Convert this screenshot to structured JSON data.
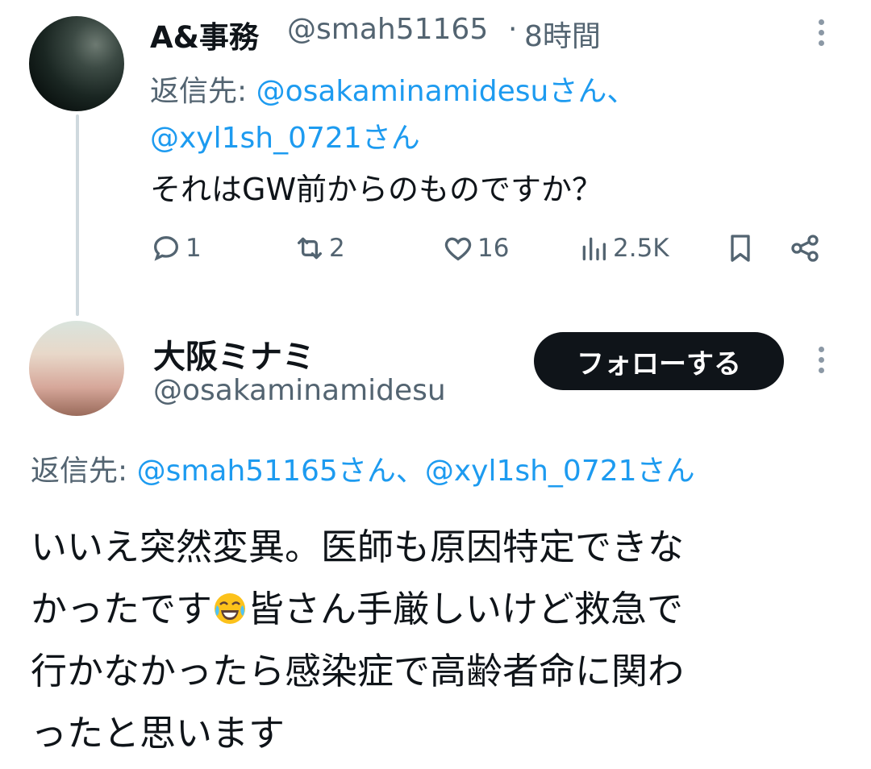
{
  "tweet1": {
    "display_name": "A&事務",
    "handle": "@smah51165",
    "separator": "·",
    "time": "8時間",
    "reply_to_label": "返信先:",
    "reply_to_line1_mention": "@osakaminamidesu",
    "reply_to_line1_suffix": "さん、",
    "reply_to_line2_mention": "@xyl1sh_0721",
    "reply_to_line2_suffix": "さん",
    "text": "それはGW前からのものですか？",
    "actions": {
      "replies": "1",
      "reposts": "2",
      "likes": "16",
      "views": "2.5K"
    }
  },
  "tweet2": {
    "display_name": "大阪ミナミ",
    "handle": "@osakaminamidesu",
    "follow_label": "フォローする",
    "reply_to_label": "返信先:",
    "reply_mention1": "@smah51165",
    "reply_sep": "さん、",
    "reply_mention2": "@xyl1sh_0721",
    "reply_suffix": "さん",
    "text_lines": [
      "いいえ突然変異。医師も原因特定できな",
      "かったです",
      "皆さん手厳しいけど救急で",
      "行かなかったら感染症で高齢者命に関わ",
      "ったと思います"
    ]
  },
  "icons": {
    "reply": "reply-icon",
    "repost": "repost-icon",
    "like": "heart-icon",
    "views": "views-icon",
    "bookmark": "bookmark-icon",
    "share": "share-icon",
    "more": "more-vertical-icon",
    "emoji": "tears-of-joy-emoji"
  },
  "colors": {
    "link": "#1d9bf0",
    "secondary_text": "#536471",
    "primary_text": "#0f1419",
    "follow_button_bg": "#0f1419"
  }
}
